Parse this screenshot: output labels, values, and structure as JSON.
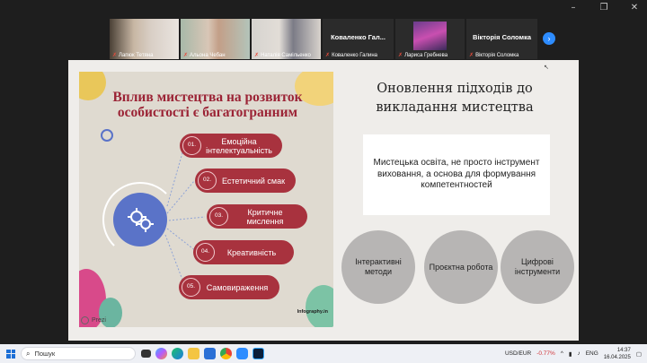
{
  "window_controls": {
    "minimize": "–",
    "restore": "❐",
    "close": "✕"
  },
  "participants": [
    {
      "name": "Лапюк Тетяна",
      "type": "video",
      "active": false
    },
    {
      "name": "Альона Чебан",
      "type": "video",
      "active": true
    },
    {
      "name": "Наталія Самільенко",
      "type": "video",
      "active": false
    },
    {
      "name": "Коваленко Галина",
      "display": "Коваленко Гал...",
      "type": "name",
      "active": false
    },
    {
      "name": "Лариса Гребнева",
      "type": "video",
      "active": false
    },
    {
      "name": "Вікторія Соломка",
      "display": "Вікторія Соломка",
      "type": "name",
      "active": false
    }
  ],
  "next_page_icon": "›",
  "slide": {
    "left_title": "Вплив мистецтва на розвиток особистості є багатогранним",
    "items": [
      {
        "num": "01.",
        "label": "Емоційна інтелектуальність"
      },
      {
        "num": "02.",
        "label": "Естетичний смак"
      },
      {
        "num": "03.",
        "label": "Критичне мислення"
      },
      {
        "num": "04.",
        "label": "Креативність"
      },
      {
        "num": "05.",
        "label": "Самовираження"
      }
    ],
    "brand": "Infography.in",
    "prezi_label": "Prezi",
    "right_title": "Оновлення підходів до викладання мистецтва",
    "quote": "Мистецька освіта,  не просто інструмент виховання, а основа для формування компетентностей",
    "circles": [
      "Інтерактивні методи",
      "Проєктна робота",
      "Цифрові інструменти"
    ]
  },
  "taskbar": {
    "search_placeholder": "Пошук",
    "currency": "USD/EUR",
    "currency_change": "-0.77%",
    "language": "ENG",
    "time": "14:37",
    "date": "16.04.2025"
  },
  "colors": {
    "accent_red": "#a8323e",
    "hub_blue": "#5a73c8",
    "active_green": "#3fd27a"
  }
}
